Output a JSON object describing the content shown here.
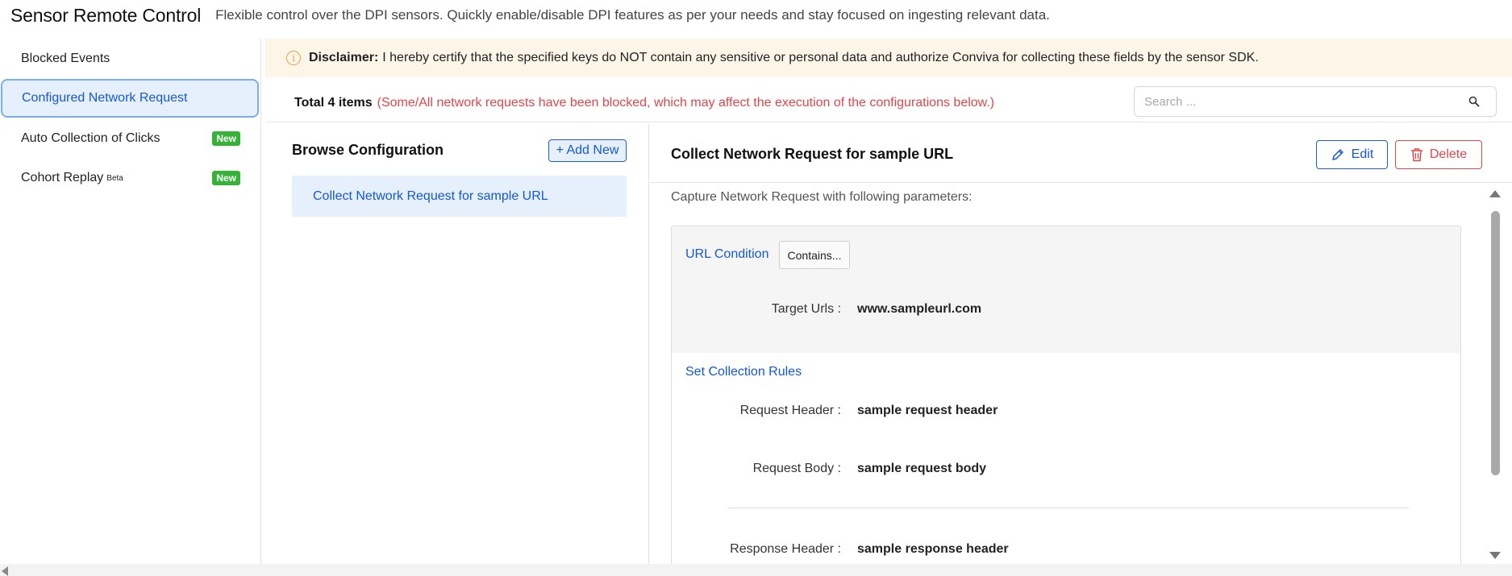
{
  "header": {
    "title": "Sensor Remote Control",
    "subtitle": "Flexible control over the DPI sensors. Quickly enable/disable DPI features as per your needs and stay focused on ingesting relevant data."
  },
  "sidebar": {
    "items": [
      {
        "label": "Blocked Events",
        "badge": "",
        "active": false
      },
      {
        "label": "Configured Network Request",
        "badge": "",
        "active": true
      },
      {
        "label": "Auto Collection of Clicks",
        "badge": "New",
        "active": false
      },
      {
        "label": "Cohort Replay",
        "sup": "Beta",
        "badge": "New",
        "active": false
      }
    ]
  },
  "disclaimer": {
    "icon": "info-icon",
    "label": "Disclaimer:",
    "text": "I hereby certify that the specified keys do NOT contain any sensitive or personal data and authorize Conviva for collecting these fields by the sensor SDK."
  },
  "list": {
    "total_prefix": "Total",
    "total_count": "4",
    "total_suffix": "items",
    "warning": "(Some/All network requests have been blocked, which may affect the execution of the configurations below.)"
  },
  "search": {
    "placeholder": "Search ..."
  },
  "browse": {
    "title": "Browse Configuration",
    "add_label": "+ Add New",
    "items": [
      "Collect Network Request for sample URL"
    ]
  },
  "detail": {
    "title": "Collect Network Request for sample URL",
    "edit_label": "Edit",
    "delete_label": "Delete",
    "capture_label": "Capture Network Request with following parameters:",
    "url_condition": {
      "title": "URL Condition",
      "operator": "Contains...",
      "target_label": "Target Urls",
      "target_value": "www.sampleurl.com"
    },
    "collection_rules": {
      "title": "Set Collection Rules",
      "request_header_label": "Request Header",
      "request_header_value": "sample request header",
      "request_body_label": "Request Body",
      "request_body_value": "sample request body",
      "response_header_label": "Response Header",
      "response_header_value": "sample response header"
    }
  },
  "colors": {
    "accent": "#1558d6",
    "danger": "#e0474a",
    "badge": "#35b336",
    "disclaimer_bg": "#fdf5e8",
    "active_bg": "#e6f0fc"
  }
}
